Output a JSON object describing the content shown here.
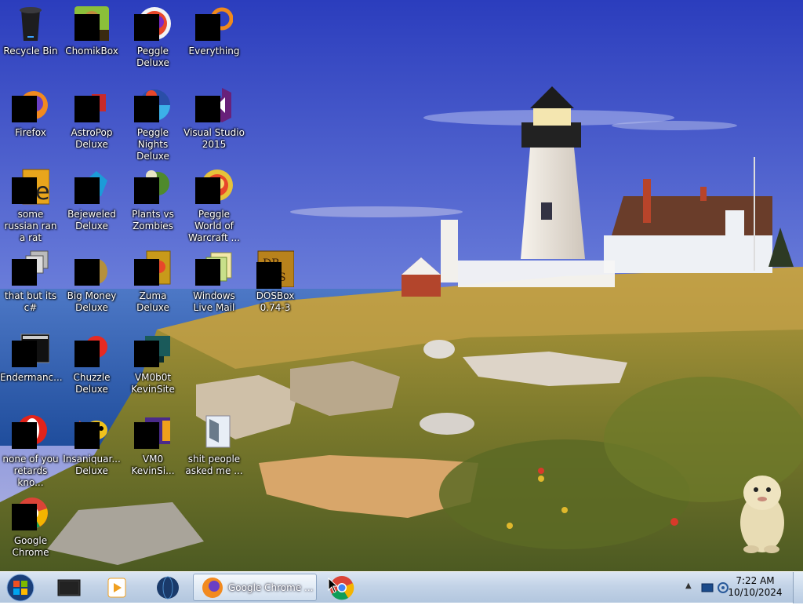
{
  "desktop": {
    "icons": [
      {
        "label": "Recycle Bin",
        "icon": "recycle-bin-icon"
      },
      {
        "label": "ChomikBox",
        "icon": "chomikbox-icon"
      },
      {
        "label": "Peggle Deluxe",
        "icon": "peggle-deluxe-icon"
      },
      {
        "label": "Everything",
        "icon": "everything-search-icon"
      },
      {
        "label": "Firefox",
        "icon": "firefox-icon"
      },
      {
        "label": "AstroPop Deluxe",
        "icon": "astropop-icon"
      },
      {
        "label": "Peggle Nights Deluxe",
        "icon": "peggle-nights-icon"
      },
      {
        "label": "Visual Studio 2015",
        "icon": "visual-studio-icon"
      },
      {
        "label": "some russian ran a rat",
        "icon": "file-e-icon"
      },
      {
        "label": "Bejeweled Deluxe",
        "icon": "bejeweled-icon"
      },
      {
        "label": "Plants vs Zombies",
        "icon": "plants-vs-zombies-icon"
      },
      {
        "label": "Peggle World of Warcraft ...",
        "icon": "peggle-wow-icon"
      },
      {
        "label": "that but its c#",
        "icon": "stack-icon"
      },
      {
        "label": "Big Money Deluxe",
        "icon": "money-bag-icon"
      },
      {
        "label": "Zuma Deluxe",
        "icon": "zuma-icon"
      },
      {
        "label": "Windows Live Mail",
        "icon": "mail-icon"
      },
      {
        "label": "DOSBox 0.74-3",
        "icon": "dosbox-icon"
      },
      {
        "label": "Endermanc...",
        "icon": "terminal-icon"
      },
      {
        "label": "Chuzzle Deluxe",
        "icon": "chuzzle-icon"
      },
      {
        "label": "VM0b0t KevinSite",
        "icon": "vm-icon"
      },
      {
        "label": "none of you retards kno...",
        "icon": "opera-icon"
      },
      {
        "label": "Insaniquar... Deluxe",
        "icon": "insaniquarium-icon"
      },
      {
        "label": "VM0 KevinSi...",
        "icon": "vm2-icon"
      },
      {
        "label": "shit people asked me ...",
        "icon": "document-icon"
      },
      {
        "label": "Google Chrome",
        "icon": "chrome-icon"
      }
    ]
  },
  "taskbar": {
    "start_icon": "windows-start-icon",
    "pinned": [
      {
        "name": "media-center-icon"
      },
      {
        "name": "media-player-icon"
      },
      {
        "name": "globe-browser-icon"
      }
    ],
    "active_task_label": "Google Chrome ...",
    "chrome_pinned": "chrome-icon",
    "clock": {
      "time": "7:22 AM",
      "date": "10/10/2024"
    },
    "tray": [
      "show-hidden-icons-chevron",
      "network-icon",
      "volume-icon"
    ]
  },
  "colors": {
    "sky_top": "#3a4fc6",
    "sky_bottom": "#9aa8e6",
    "sea": "#2f5fb0",
    "grass": "#9a8a3a",
    "taskbar": "#c3d3e7"
  }
}
